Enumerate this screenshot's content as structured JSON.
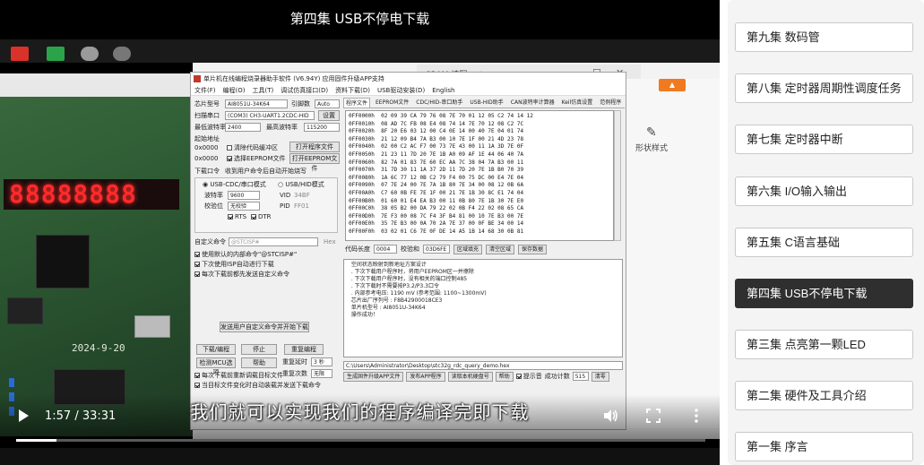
{
  "video": {
    "title": "第四集 USB不停电下载",
    "subtitle": "我们就可以实现我们的程序编译完即下载",
    "current_time": "1:57",
    "duration": "33:31",
    "progress": 0.058
  },
  "board": {
    "display_digits": "88888888",
    "silk_date": "2024-9-20"
  },
  "background_window": {
    "tab_label": "SRAM 读写.ppt",
    "ribbon_item": "形状样式"
  },
  "isp": {
    "title": "单片机在线编程烧录器助手软件 (V6.94Y) 应用固件升级APP支持",
    "menu": [
      "文件(F)",
      "编程(O)",
      "工具(T)",
      "调试仿真接口(D)",
      "资料下载(D)",
      "USB驱动安装(D)",
      "English"
    ],
    "mcu_label": "芯片型号",
    "mcu_value": "AI8051U-34K64",
    "pins_label": "引脚数",
    "pins_value": "Auto",
    "port_label": "扫描串口",
    "port_value": "(COM3) CH3-UART1.2CDC-HID",
    "scan_button": "设置",
    "min_baud_label": "最低波特率",
    "min_baud_value": "2400",
    "max_baud_label": "最高波特率",
    "max_baud_value": "115200",
    "start_addr_label": "起始地址",
    "addr1": "0x0000",
    "addr2": "0x0000",
    "clear_code": "清除代码缓冲区",
    "clear_eeprom": "选择EEPROM文件",
    "open_program": "打开程序文件",
    "open_eeprom": "打开EEPROM文件",
    "hw_option_label": "下载口令",
    "hw_option_value": "收到用户命令后自动开始烧写",
    "radio_usb": "USB-CDC/串口模式",
    "radio_usb_hid": "USB/HID模式",
    "baud_label": "波特率",
    "baud_value": "9600",
    "parity_label": "校验位",
    "parity_value": "无校验",
    "vid_label": "VID",
    "vid_value": "34BF",
    "pid_label": "PID",
    "pid_value": "FF01",
    "rts_label": "RTS",
    "dtr_label": "DTR",
    "custom_cmd_label": "自定义命令",
    "custom_cmd_value": "@STCISP#",
    "custom_cmd_unit": "Hex",
    "opt1": "使用默认的内部命令\"@STCISP#\"",
    "opt2": "下次使用ISP自动进行下载",
    "opt3": "每次下载前都先发送自定义命令",
    "send_custom": "发送用户自定义命令并开始下载",
    "download_button": "下载/编程",
    "stop_button": "停止",
    "reprogram_button": "重复编程",
    "check_mcu_button": "检测MCU选项",
    "help_button": "帮助",
    "retry_delay_label": "重复延时",
    "retry_delay_value": "3 秒",
    "retry_count_label": "重复次数",
    "retry_count_value": "无限",
    "reload_check": "每次下载前重新调载目标文件",
    "auto_check": "当目标文件变化时自动装载并发送下载命令",
    "tabs": [
      "程序文件",
      "EEPROM文件",
      "CDC/HID-串口助手",
      "USB-HID助手",
      "CAN波特率计算器",
      "Keil仿真设置",
      "范例程序"
    ],
    "hex_rows": [
      "0FF0000h  02 09 39 CA 79 76 08 7E 70 01 12 05 C2 74 14 12",
      "0FF0010h  08 AD 7C FB 08 E4 08 74 14 7E 70 12 08 C2 7C",
      "0FF0020h  8F 20 E6 03 12 00 C4 0E 14 00 40 7E 04 01 74",
      "0FF0030h  21 12 09 B4 7A B3 00 10 7E 1F 00 21 4D 23 78",
      "0FF0040h  02 00 C2 AC F7 00 73 7E 43 00 11 1A 3D 7E 0F",
      "0FF0050h  21 23 11 7D 20 7E 1B A0 09 AF 1E 44 06 40 7A",
      "0FF0060h  82 7A 01 83 7E 60 EC AA 7C 38 04 7A B3 00 11",
      "0FF0070h  31 7D 30 11 1A 37 2D 11 7D 20 7E 1B B0 70 39",
      "0FF0080h  1A 6C 77 12 0B C2 79 F4 00 75 DC 00 E4 7E 04",
      "0FF0090h  07 7E 24 00 7E 7A 1B 80 7E 34 00 08 12 0B 6A",
      "0FF00A0h  C7 60 0B FE 7E 1F 00 21 7E 1B 30 8C E1 74 04",
      "0FF00B0h  01 60 01 E4 EA B3 00 11 0B 80 7E 1B 30 7E E0",
      "0FF00C0h  38 05 B2 00 DA 79 22 02 0B F4 22 02 08 65 CA",
      "0FF00D0h  7E F3 00 08 7C F4 3F B4 81 00 10 7E B3 00 7E",
      "0FF00E0h  35 7E B3 00 0A 70 2A 7E 37 00 0F BE 34 00 14",
      "0FF00F0h  03 02 01 C6 7E 0F DE 14 A5 1B 14 68 30 0B 81"
    ],
    "checksum_label": "代码长度",
    "checksum_value": "0004",
    "check_label": "校验和",
    "check_value": "03D6FE",
    "fill_button": "区域填充",
    "clear_button": "清空区域",
    "save_button": "保存数据",
    "log_lines": [
      "  空间状态映射到新地址方案设计",
      "  . 下次下载用户程序时，将用户EEPROM区一并擦除",
      "  . 下次下载用户程序时，没有相关的端口控制485",
      "  . 下次下载时不需要按P3.2/P3.3口令",
      "  . 内部参考电压: 1190 mV (参考范围: 1100~1300mV)",
      "  芯片出厂序列号 : F8B42900018CE3",
      "",
      "  单片机型号 : AI8051U-34K64",
      "",
      "  操作成功！"
    ],
    "path_value": "C:\\Users\\Administrator\\Desktop\\stc32g_rdc_query_demo.hex",
    "bottom_buttons": [
      "生成固件升级APP文件",
      "发布APP程序",
      "读取本机硬盘号",
      "帮助"
    ],
    "beep_label": "提示音",
    "success_label": "成功计数",
    "success_value": "515",
    "clear_count": "清零"
  },
  "playlist": {
    "active_index": 5,
    "items": [
      "第九集 数码管",
      "第八集 定时器周期性调度任务",
      "第七集 定时器中断",
      "第六集 I/O输入输出",
      "第五集 C语言基础",
      "第四集 USB不停电下载",
      "第三集 点亮第一颗LED",
      "第二集 硬件及工具介绍",
      "第一集 序言"
    ]
  }
}
